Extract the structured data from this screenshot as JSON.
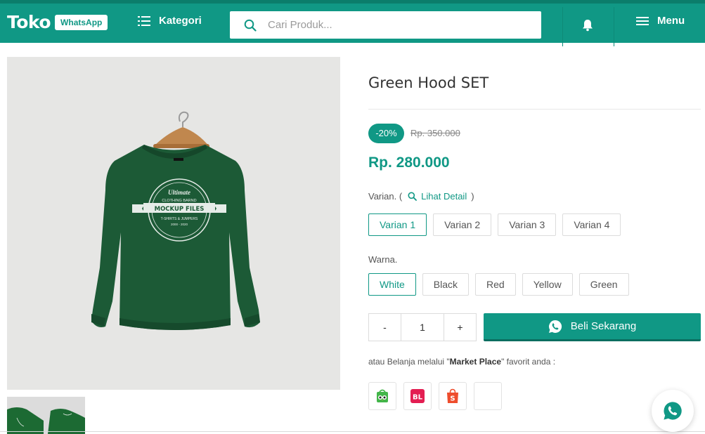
{
  "header": {
    "logo_text": "Toko",
    "logo_badge": "WhatsApp",
    "kategori_label": "Kategori",
    "search_placeholder": "Cari Produk...",
    "menu_label": "Menu"
  },
  "product": {
    "title": "Green Hood SET",
    "discount_badge": "-20%",
    "old_price": "Rp. 350.000",
    "price": "Rp. 280.000",
    "varian_label": "Varian. (",
    "varian_detail_link": "Lihat Detail",
    "varian_close": ")",
    "varian_options": [
      "Varian 1",
      "Varian 2",
      "Varian 3",
      "Varian 4"
    ],
    "varian_selected": "Varian 1",
    "warna_label": "Warna.",
    "warna_options": [
      "White",
      "Black",
      "Red",
      "Yellow",
      "Green"
    ],
    "warna_selected": "White",
    "qty_minus": "-",
    "qty_value": "1",
    "qty_plus": "+",
    "buy_label": "Beli Sekarang",
    "market_text_before": "atau Belanja melalui \"",
    "market_text_bold": "Market Place",
    "market_text_after": "\" favorit anda :"
  },
  "image": {
    "badge_top": "Ultimate",
    "badge_sub": "CLOTHING BARND",
    "badge_ribbon": "MOCKUP FILES",
    "badge_line": "T-SHIRTS & JUMPERS",
    "badge_year": "2000 - 2020"
  },
  "marketplaces": [
    "tokopedia",
    "bukalapak",
    "shopee",
    "blank"
  ],
  "marketplace_labels": {
    "bukalapak": "BL",
    "shopee": "S"
  },
  "colors": {
    "primary": "#109885",
    "primary_dark": "#0b7d6b",
    "shirt": "#1c5a36"
  }
}
